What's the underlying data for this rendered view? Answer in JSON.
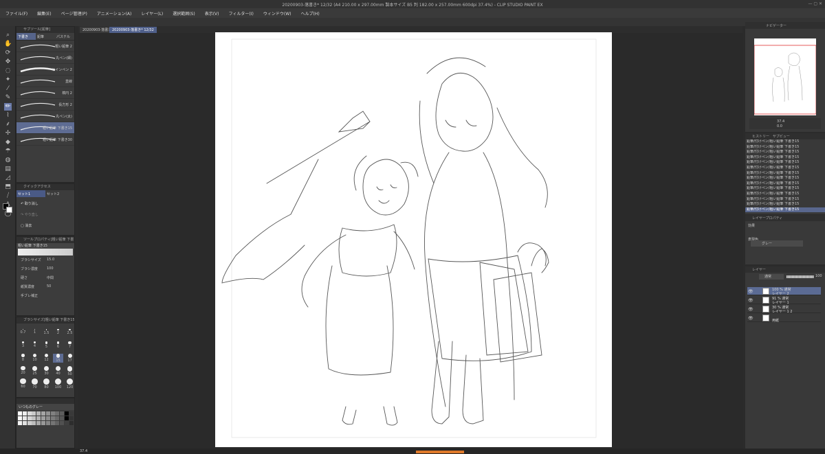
{
  "window": {
    "title": "20200903-落書き* 12/32 (A4 210.00 x 297.00mm 製本サイズ B5 判 182.00 x 257.00mm 600dpi 37.4%) - CLIP STUDIO PAINT EX"
  },
  "menu": [
    "ファイル(F)",
    "編集(E)",
    "ページ管理(P)",
    "アニメーション(A)",
    "レイヤー(L)",
    "選択範囲(S)",
    "表示(V)",
    "フィルター(I)",
    "ウィンドウ(W)",
    "ヘルプ(H)"
  ],
  "tabs": [
    {
      "label": "20200903-落書き"
    },
    {
      "label": "20200903-落書き* 12/32"
    }
  ],
  "subtool": {
    "header": "サブツール[鉛筆]",
    "groups": [
      "下書き",
      "鉛筆",
      "パステル"
    ],
    "brushes": [
      "粗い鉛筆 2",
      "丸ペン(細)",
      "サインペン 2",
      "直線",
      "楕円 2",
      "長方形 2",
      "丸ペン(太)",
      "粗い鉛筆 下書き15",
      "粗い鉛筆 下書き30"
    ]
  },
  "quick_access": {
    "header": "クイックアクセス",
    "sets": [
      "セット1",
      "セット2"
    ],
    "items": [
      "取り消し",
      "やり直し",
      "消去"
    ]
  },
  "tool_property": {
    "header": "ツールプロパティ[粗い鉛筆 下書き15]",
    "brush_name": "粗い鉛筆 下書き15",
    "rows": [
      {
        "label": "ブラシサイズ",
        "value": "15.0"
      },
      {
        "label": "ブラシ濃度",
        "value": "100"
      },
      {
        "label": "硬さ",
        "value": "中間"
      },
      {
        "label": "紙質濃度",
        "value": "50"
      },
      {
        "label": "手ブレ補正",
        "value": ""
      }
    ]
  },
  "brush_size": {
    "header": "ブラシサイズ[粗い鉛筆 下書き15]",
    "sizes": [
      "0.7",
      "1",
      "1.5",
      "2",
      "2.5",
      "3",
      "4",
      "5",
      "6",
      "7",
      "8",
      "10",
      "12",
      "15",
      "17",
      "20",
      "25",
      "30",
      "40",
      "50",
      "60",
      "70",
      "80",
      "100",
      "120"
    ],
    "selected": "15"
  },
  "color_set": {
    "selected": "いつものグレー"
  },
  "colors": {
    "accent": "#5e6c93",
    "panel": "#3c3c3c",
    "canvas_bg": "#2a2a2a",
    "paper": "#ffffff",
    "navigator_frame": "#e03030"
  },
  "navigator": {
    "header": "ナビゲーター",
    "zoom": "37.4",
    "angle": "0.0"
  },
  "history": {
    "header": "ヒストリー",
    "second_tab": "サブビュー",
    "rows": [
      "鉛筆/付けペン/粗い鉛筆 下書き15",
      "鉛筆/付けペン/粗い鉛筆 下書き15",
      "鉛筆/付けペン/粗い鉛筆 下書き15",
      "鉛筆/付けペン/粗い鉛筆 下書き15",
      "鉛筆/付けペン/粗い鉛筆 下書き15",
      "鉛筆/付けペン/粗い鉛筆 下書き15",
      "鉛筆/付けペン/粗い鉛筆 下書き15",
      "鉛筆/付けペン/粗い鉛筆 下書き15",
      "鉛筆/付けペン/粗い鉛筆 下書き15",
      "鉛筆/付けペン/粗い鉛筆 下書き15",
      "鉛筆/付けペン/粗い鉛筆 下書き15",
      "鉛筆/付けペン/粗い鉛筆 下書き15",
      "鉛筆/付けペン/粗い鉛筆 下書き15",
      "鉛筆/付けペン/粗い鉛筆 下書き15"
    ],
    "selected_index": 13
  },
  "layer_property": {
    "header": "レイヤープロパティ",
    "effect_label": "効果",
    "expression_label": "表現色",
    "expression_value": "グレー"
  },
  "layers_panel": {
    "header": "レイヤー",
    "blend": "通常",
    "opacity": "100",
    "layers": [
      {
        "opacity": "100 % 通常",
        "name": "レイヤー 2"
      },
      {
        "opacity": "91 % 通常",
        "name": "レイヤー 1"
      },
      {
        "opacity": "30 % 通常",
        "name": "レイヤー 1 2"
      },
      {
        "opacity": "",
        "name": "用紙"
      }
    ]
  },
  "status": {
    "zoom": "37.4"
  }
}
